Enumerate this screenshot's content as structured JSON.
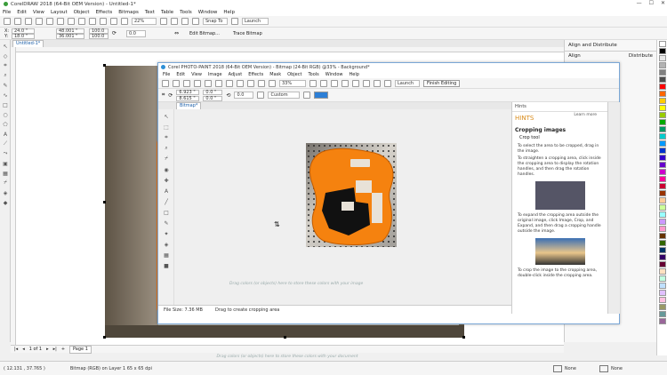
{
  "main_window": {
    "title": "CorelDRAW 2018 (64-Bit OEM Version) - Untitled-1*",
    "menu": [
      "File",
      "Edit",
      "View",
      "Layout",
      "Object",
      "Effects",
      "Bitmaps",
      "Text",
      "Table",
      "Tools",
      "Window",
      "Help"
    ],
    "toolbar": {
      "zoom": "22%",
      "snap_to": "Snap To",
      "launch": "Launch"
    },
    "propbar": {
      "x": "24.0 \"",
      "y": "18.0 \"",
      "w": "48.001 \"",
      "h": "36.001 \"",
      "sx": "100.0",
      "sy": "100.0",
      "angle": "0.0",
      "edit_bitmap": "Edit Bitmap...",
      "trace_bitmap": "Trace Bitmap"
    },
    "doc_tab": "Untitled-1*",
    "page_nav": {
      "page_of": "1 of 1",
      "page_tab": "Page 1"
    },
    "drop_hint": "Drag colors (or objects) here to store these colors with your document",
    "status": {
      "coords": "( 12.131 , 37.765 )",
      "object_info": "Bitmap (RGB) on Layer 1 65 x 65 dpi",
      "fill": "None",
      "outline": "None"
    }
  },
  "right_panel": {
    "title": "Align and Distribute",
    "align": "Align",
    "distribute": "Distribute"
  },
  "photopaint": {
    "title": "Corel PHOTO-PAINT 2018 (64-Bit OEM Version) - Bitmap (24-Bit RGB) @33% - Background*",
    "menu": [
      "File",
      "Edit",
      "View",
      "Image",
      "Adjust",
      "Effects",
      "Mask",
      "Object",
      "Tools",
      "Window",
      "Help"
    ],
    "toolbar": {
      "zoom": "33%",
      "launch": "Launch",
      "finish": "Finish Editing"
    },
    "propbar": {
      "x": "6.923 \"",
      "y": "8.615 \"",
      "w": "0.0 \"",
      "h": "0.0 \"",
      "angle": "0.0",
      "mode": "Custom"
    },
    "doc_tab": "Bitmap*",
    "drop_hint": "Drag colors (or objects) here to store these colors with your image",
    "status": {
      "file_size": "File Size: 7.36 MB",
      "hint": "Drag to create cropping area"
    },
    "hints": {
      "header": "Hints",
      "title": "HINTS",
      "learn_more": "Learn more",
      "section": "Cropping images",
      "tool": "Crop tool",
      "paragraphs": [
        "To select the area to be cropped, drag in the image.",
        "To straighten a cropping area, click inside the cropping area to display the rotation handles, and then drag the rotation handles.",
        "To expand the cropping area outside the original image, click Image, Crop, and Expand, and then drag a cropping handle outside the image.",
        "To crop the image to the cropping area, double-click inside the cropping area."
      ]
    }
  },
  "palette_colors": [
    "#ffffff",
    "#000000",
    "#e6e6e6",
    "#b3b3b3",
    "#808080",
    "#4d4d4d",
    "#ff0000",
    "#ff6600",
    "#ffcc00",
    "#ffff00",
    "#99cc00",
    "#00aa00",
    "#009966",
    "#00cccc",
    "#0099ff",
    "#0033cc",
    "#3300cc",
    "#6600cc",
    "#cc00cc",
    "#ff0099",
    "#cc0033",
    "#993300",
    "#ffcc99",
    "#ccff99",
    "#99ffff",
    "#cc99ff",
    "#ff99cc",
    "#663300",
    "#336600",
    "#003366",
    "#330066",
    "#660033",
    "#ffe0c0",
    "#c0ffe0",
    "#c0e0ff",
    "#e0c0ff",
    "#ffc0e0",
    "#999966",
    "#669999",
    "#996699"
  ]
}
